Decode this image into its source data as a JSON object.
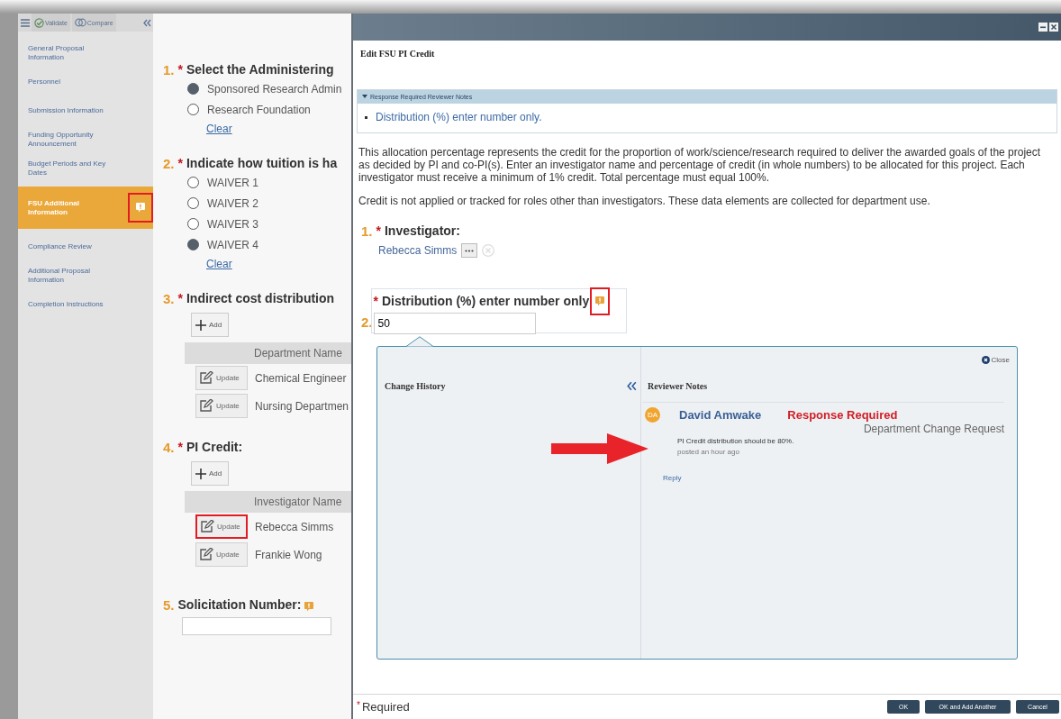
{
  "sidebar": {
    "toolbar": [
      {
        "label": "Validate",
        "kind": "validate"
      },
      {
        "label": "Compare",
        "kind": "compare"
      }
    ],
    "items": [
      {
        "label": "General Proposal Information",
        "selected": false,
        "note": false,
        "highlighted": false
      },
      {
        "label": "Personnel",
        "selected": false,
        "note": false,
        "highlighted": false
      },
      {
        "label": "Submission Information",
        "selected": false,
        "note": false,
        "highlighted": false
      },
      {
        "label": "Funding Opportunity Announcement",
        "selected": false,
        "note": false,
        "highlighted": false
      },
      {
        "label": "Budget Periods and Key Dates",
        "selected": false,
        "note": false,
        "highlighted": false
      },
      {
        "label": "FSU Additional Information",
        "selected": true,
        "note": true,
        "highlighted": true
      },
      {
        "label": "Compliance Review",
        "selected": false,
        "note": false,
        "highlighted": false
      },
      {
        "label": "Additional Proposal Information",
        "selected": false,
        "note": false,
        "highlighted": false
      },
      {
        "label": "Completion Instructions",
        "selected": false,
        "note": false,
        "highlighted": false
      }
    ]
  },
  "questions": [
    {
      "number": "1.",
      "marker": "*",
      "title": "Select the Administering",
      "kind": "radio",
      "options": [
        {
          "label": "Sponsored Research Admin",
          "selected": true
        },
        {
          "label": "Research Foundation",
          "selected": false
        }
      ],
      "clear": "Clear"
    },
    {
      "number": "2.",
      "marker": "*",
      "title": "Indicate how tuition is ha",
      "kind": "radio",
      "options": [
        {
          "label": "WAIVER 1",
          "selected": false
        },
        {
          "label": "WAIVER 2",
          "selected": false
        },
        {
          "label": "WAIVER 3",
          "selected": false
        },
        {
          "label": "WAIVER 4",
          "selected": true
        }
      ],
      "clear": "Clear"
    },
    {
      "number": "3.",
      "marker": "*",
      "title": "Indirect cost distribution",
      "kind": "table",
      "add": "Add",
      "column": "Department Name",
      "rows": [
        {
          "button": "Update",
          "cell": "Chemical Engineer",
          "highlighted": false
        },
        {
          "button": "Update",
          "cell": "Nursing Departmen",
          "highlighted": false
        }
      ]
    },
    {
      "number": "4.",
      "marker": "*",
      "title": "PI Credit:",
      "kind": "table",
      "add": "Add",
      "column": "Investigator Name",
      "rows": [
        {
          "button": "Update",
          "cell": "Rebecca Simms",
          "highlighted": true
        },
        {
          "button": "Update",
          "cell": "Frankie Wong",
          "highlighted": false
        }
      ]
    },
    {
      "number": "5.",
      "title": "Solicitation Number:",
      "kind": "text",
      "note": true
    }
  ],
  "dialog": {
    "heading": "Edit FSU PI Credit",
    "notes_panel": {
      "title": "Response Required Reviewer Notes",
      "expanded": true,
      "items": [
        "Distribution (%) enter number only."
      ]
    },
    "paragraphs": [
      "This allocation percentage represents the credit for the proportion of work/science/research required to deliver the awarded goals of the project as decided by PI and co-PI(s). Enter an investigator name and percentage of credit (in whole numbers) to be allocated for this project. Each investigator must receive a minimum of 1% credit. Total percentage must equal 100%.",
      "Credit is not applied or tracked for roles other than investigators. These data elements are collected for department use."
    ],
    "fields": [
      {
        "number": "1.",
        "marker": "*",
        "label": "Investigator:",
        "kind": "person",
        "value": "Rebecca Simms"
      },
      {
        "number": "2.",
        "marker": "*",
        "label": "Distribution (%) enter number only",
        "kind": "number",
        "value": "50",
        "note": true,
        "highlighted": true
      }
    ],
    "popover": {
      "close": "Close",
      "history_title": "Change History",
      "notes_title": "Reviewer Notes",
      "notes": [
        {
          "initials": "DA",
          "author": "David Amwake",
          "status": "Response Required",
          "type": "Department Change Request",
          "text": "PI Credit distribution should be 80%.",
          "posted": "posted an hour ago",
          "reply": "Reply",
          "pointer_arrow": true
        }
      ]
    },
    "footer": {
      "marker": "*",
      "label": "Required",
      "buttons": [
        "OK",
        "OK and Add Another",
        "Cancel"
      ]
    }
  }
}
